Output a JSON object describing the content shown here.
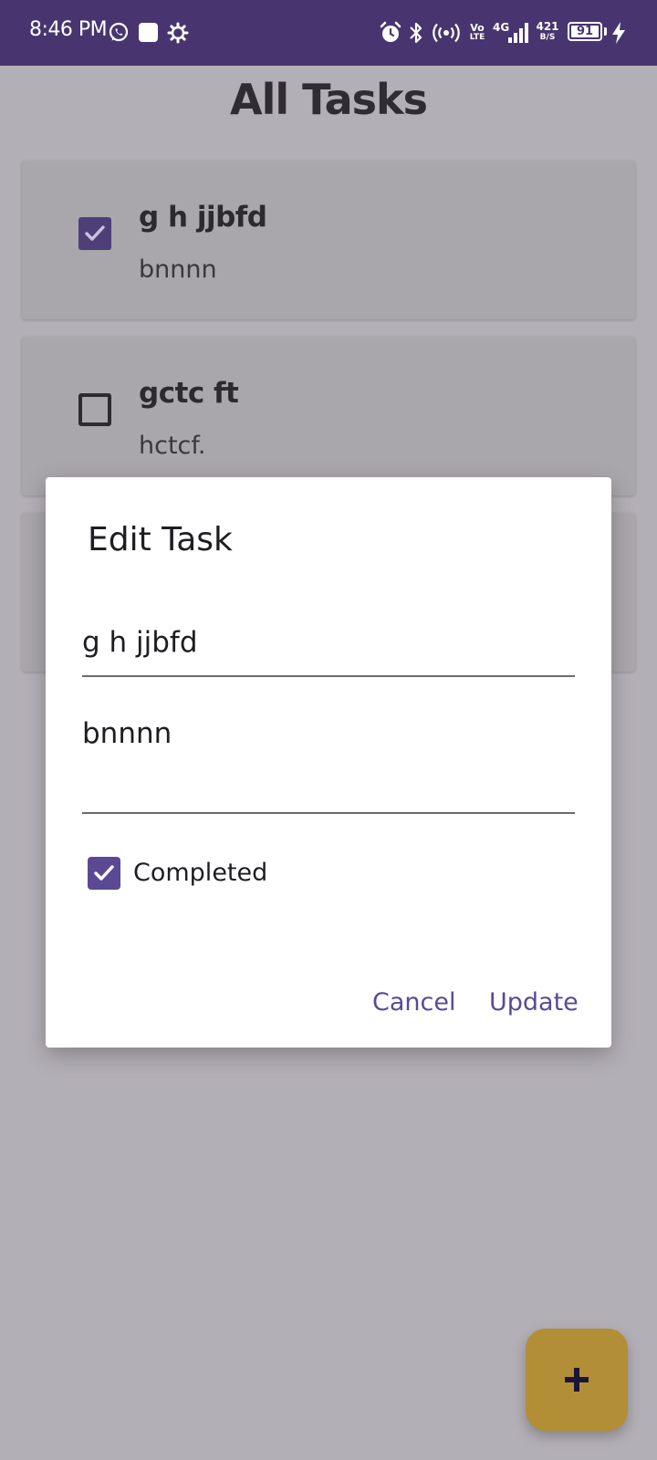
{
  "status_bar": {
    "time": "8:46 PM",
    "volte_top": "Vo",
    "volte_bottom": "LTE",
    "network": "4G",
    "speed_value": "421",
    "speed_unit": "B/S",
    "battery": "91"
  },
  "page": {
    "title": "All Tasks"
  },
  "tasks": [
    {
      "title": "g h jjbfd",
      "description": "bnnnn",
      "completed": true
    },
    {
      "title": "gctc ft",
      "description": "hctcf.",
      "completed": false
    }
  ],
  "dialog": {
    "title": "Edit Task",
    "title_field_value": "g h jjbfd",
    "description_field_value": "bnnnn",
    "completed_label": "Completed",
    "completed": true,
    "cancel_label": "Cancel",
    "update_label": "Update"
  },
  "colors": {
    "status_bar": "#48356f",
    "accent": "#5b4a93",
    "fab": "#b28f36",
    "scrim_background": "#b3afb6"
  },
  "fab": {
    "icon": "plus-icon"
  }
}
